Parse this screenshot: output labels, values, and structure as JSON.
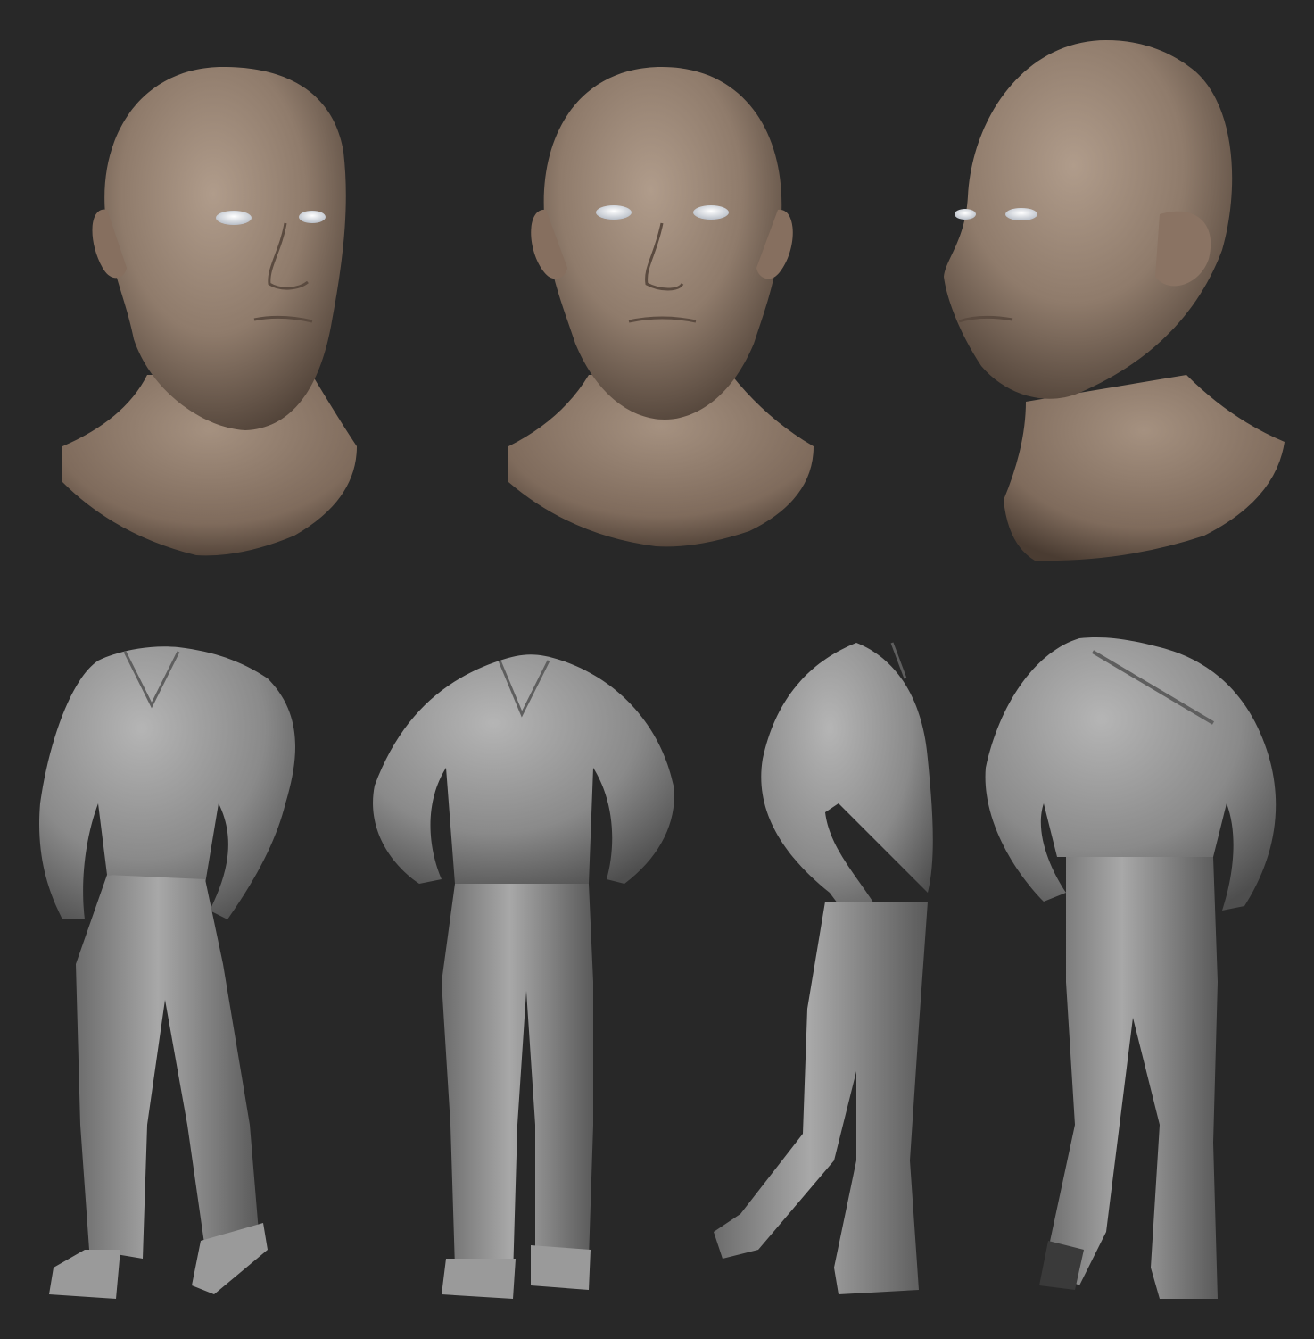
{
  "image": {
    "kind": "3d-sculpt-turnaround",
    "background_color": "#282828",
    "skin_color": "#9a8676",
    "clay_color": "#8f8f8f",
    "eye_color": "#e6e9ee"
  },
  "heads": [
    {
      "view": "three-quarter-right"
    },
    {
      "view": "front"
    },
    {
      "view": "three-quarter-left"
    }
  ],
  "bodies": [
    {
      "view": "three-quarter-front-right"
    },
    {
      "view": "front"
    },
    {
      "view": "side-left"
    },
    {
      "view": "back"
    }
  ]
}
